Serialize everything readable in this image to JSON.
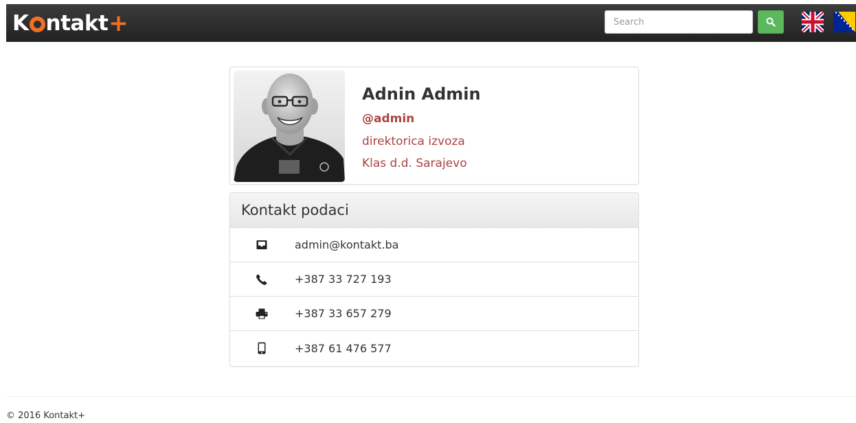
{
  "navbar": {
    "logo": {
      "prefix": "K",
      "suffix": "ntakt",
      "plus": "+"
    },
    "search": {
      "placeholder": "Search",
      "value": "",
      "button_icon": "search-icon"
    },
    "languages": [
      {
        "name": "English",
        "icon": "uk-flag-icon"
      },
      {
        "name": "Bosanski",
        "icon": "bosnia-flag-icon"
      }
    ]
  },
  "profile": {
    "name": "Adnin Admin",
    "username": "@admin",
    "title": "direktorica izvoza",
    "company": "Klas d.d. Sarajevo"
  },
  "contact": {
    "heading": "Kontakt podaci",
    "items": [
      {
        "icon": "inbox-icon",
        "value": "admin@kontakt.ba"
      },
      {
        "icon": "phone-icon",
        "value": "+387 33 727 193"
      },
      {
        "icon": "fax-icon",
        "value": "+387 33 657 279"
      },
      {
        "icon": "mobile-icon",
        "value": "+387 61 476 577"
      }
    ]
  },
  "footer": {
    "copyright": "© 2016 Kontakt+"
  },
  "colors": {
    "navbar": "#2b2b2b",
    "brand_orange": "#f37021",
    "search_button": "#5cb85c",
    "accent_red": "#a94442"
  }
}
